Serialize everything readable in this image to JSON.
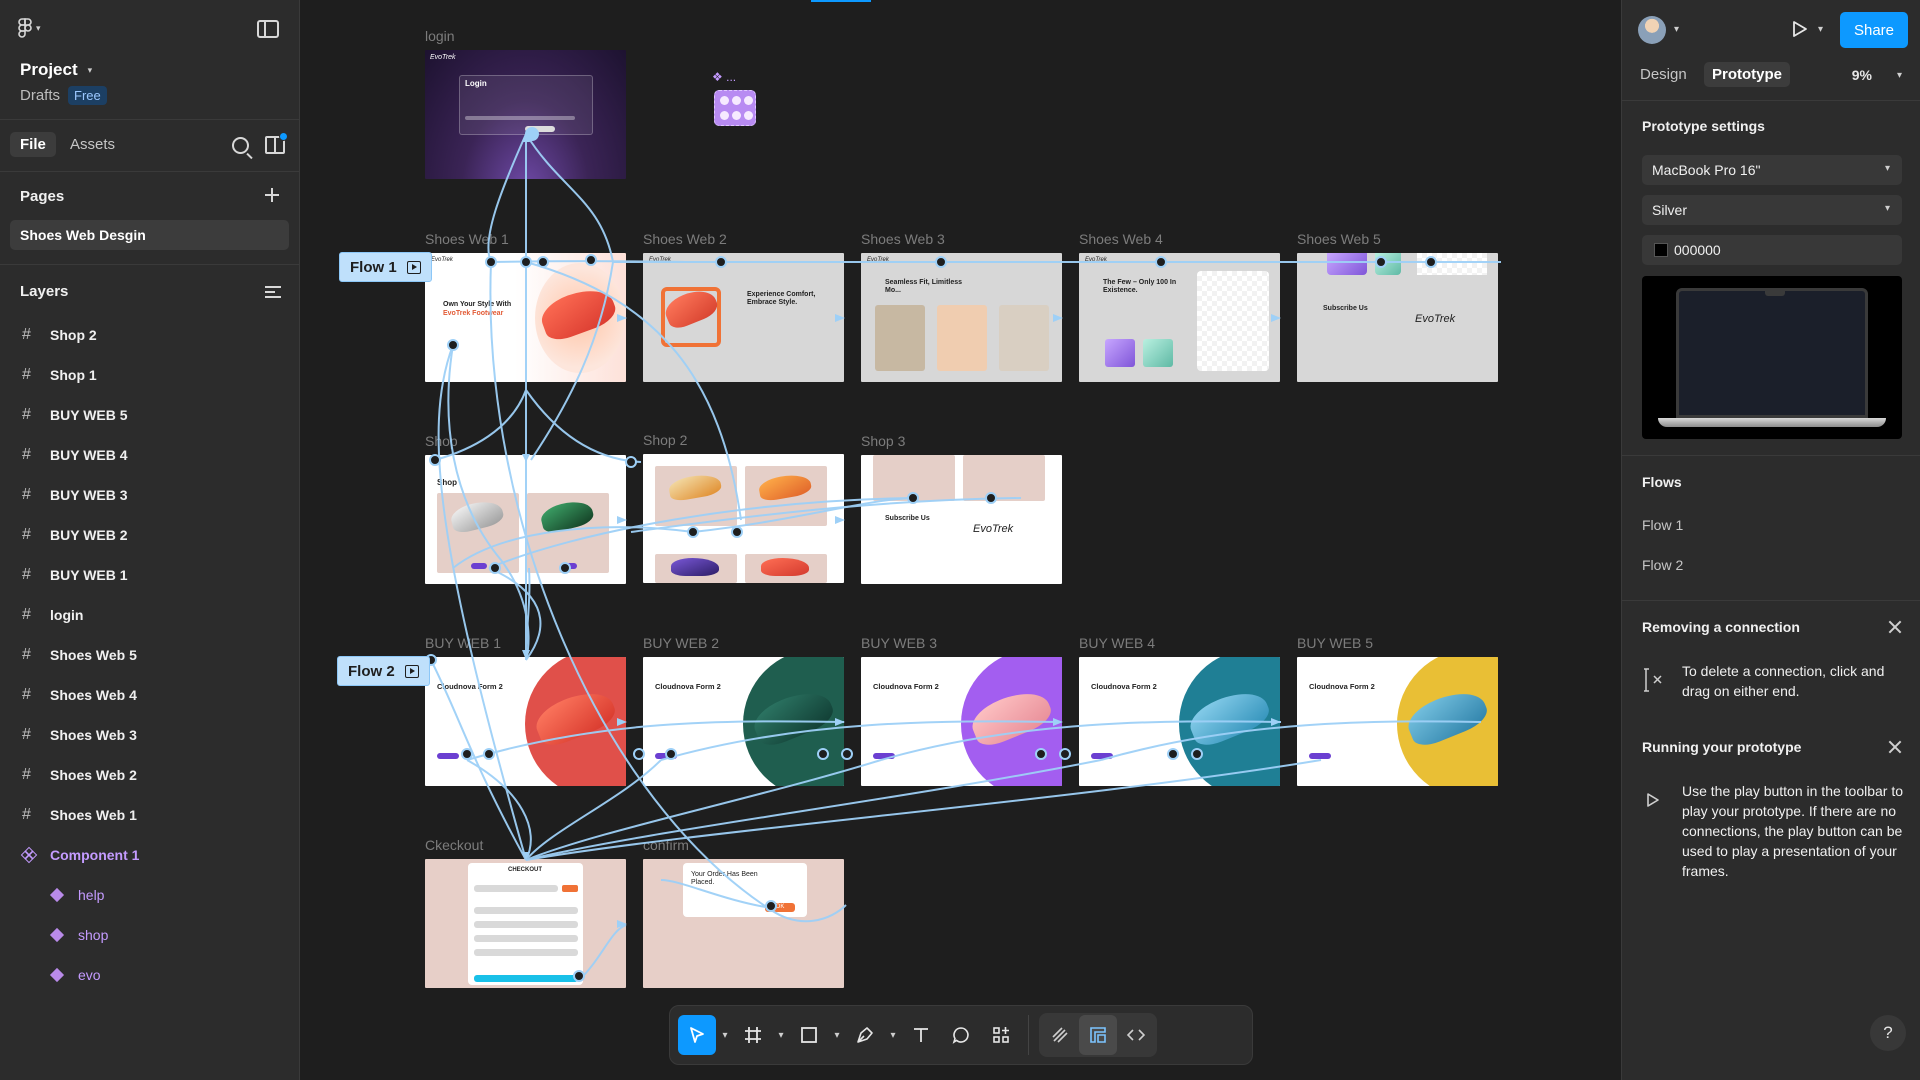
{
  "app": {
    "project_name": "Project",
    "drafts_label": "Drafts",
    "plan_badge": "Free"
  },
  "left_panel": {
    "tabs": {
      "file": "File",
      "assets": "Assets"
    },
    "pages_title": "Pages",
    "current_page": "Shoes Web Desgin",
    "layers_title": "Layers",
    "layers": [
      {
        "label": "Shop 2",
        "kind": "frame"
      },
      {
        "label": "Shop 1",
        "kind": "frame"
      },
      {
        "label": "BUY WEB 5",
        "kind": "frame"
      },
      {
        "label": "BUY WEB 4",
        "kind": "frame"
      },
      {
        "label": "BUY WEB 3",
        "kind": "frame"
      },
      {
        "label": "BUY WEB 2",
        "kind": "frame"
      },
      {
        "label": "BUY WEB 1",
        "kind": "frame"
      },
      {
        "label": "login",
        "kind": "frame"
      },
      {
        "label": "Shoes Web 5",
        "kind": "frame"
      },
      {
        "label": "Shoes Web 4",
        "kind": "frame"
      },
      {
        "label": "Shoes Web 3",
        "kind": "frame"
      },
      {
        "label": "Shoes Web 2",
        "kind": "frame"
      },
      {
        "label": "Shoes Web 1",
        "kind": "frame"
      },
      {
        "label": "Component 1",
        "kind": "component-set"
      },
      {
        "label": "help",
        "kind": "component"
      },
      {
        "label": "shop",
        "kind": "component"
      },
      {
        "label": "evo",
        "kind": "component"
      }
    ]
  },
  "canvas": {
    "frame_labels": {
      "login": "login",
      "sw1": "Shoes Web 1",
      "sw2": "Shoes Web 2",
      "sw3": "Shoes Web 3",
      "sw4": "Shoes Web 4",
      "sw5": "Shoes Web 5",
      "shop": "Shop",
      "shop2": "Shop 2",
      "shop3": "Shop 3",
      "bw1": "BUY WEB 1",
      "bw2": "BUY WEB 2",
      "bw3": "BUY WEB 3",
      "bw4": "BUY WEB 4",
      "bw5": "BUY WEB 5",
      "checkout": "Ckeckout",
      "confirm": "confirm"
    },
    "flow_tags": {
      "flow1": "Flow 1",
      "flow2": "Flow 2"
    },
    "component_label": "...",
    "frame_text": {
      "login_title": "Login",
      "evotrek": "EvoTrek",
      "sw1_headline_a": "Own Your Style With",
      "sw1_headline_b": "EvoTrek Footwear",
      "sw2_headline": "Experience Comfort, Embrace Style.",
      "sw3_headline": "Seamless Fit, Limitless Mo...",
      "sw4_headline": "The Few – Only 100 In Existence.",
      "subscribe": "Subscribe Us",
      "shop_title": "Shop",
      "buy_title": "Cloudnova Form 2",
      "checkout_title": "CHECKOUT",
      "confirm_text": "Your Order Has Been Placed.",
      "ok": "OK"
    }
  },
  "toolbar": {
    "tools": [
      "move-tool",
      "frame-tool",
      "shape-tool",
      "pen-tool",
      "text-tool",
      "comment-tool",
      "actions-tool"
    ],
    "modes": [
      "draw-mode",
      "design-mode",
      "dev-mode"
    ]
  },
  "right_panel": {
    "share_label": "Share",
    "tabs": {
      "design": "Design",
      "prototype": "Prototype"
    },
    "zoom": "9%",
    "settings_title": "Prototype settings",
    "device": "MacBook Pro 16\"",
    "device_color": "Silver",
    "background_hex": "000000",
    "flows_title": "Flows",
    "flows": [
      "Flow 1",
      "Flow 2"
    ],
    "tip_remove_title": "Removing a connection",
    "tip_remove_body": "To delete a connection, click and drag on either end.",
    "tip_run_title": "Running your prototype",
    "tip_run_body": "Use the play button in the toolbar to play your prototype. If there are no connections, the play button can be used to play a presentation of your frames.",
    "help": "?"
  },
  "colors": {
    "accent": "#0d99ff",
    "connection": "#9ed0f7",
    "component": "#c49bff",
    "panel": "#2c2c2c",
    "canvas": "#1e1e1e"
  }
}
